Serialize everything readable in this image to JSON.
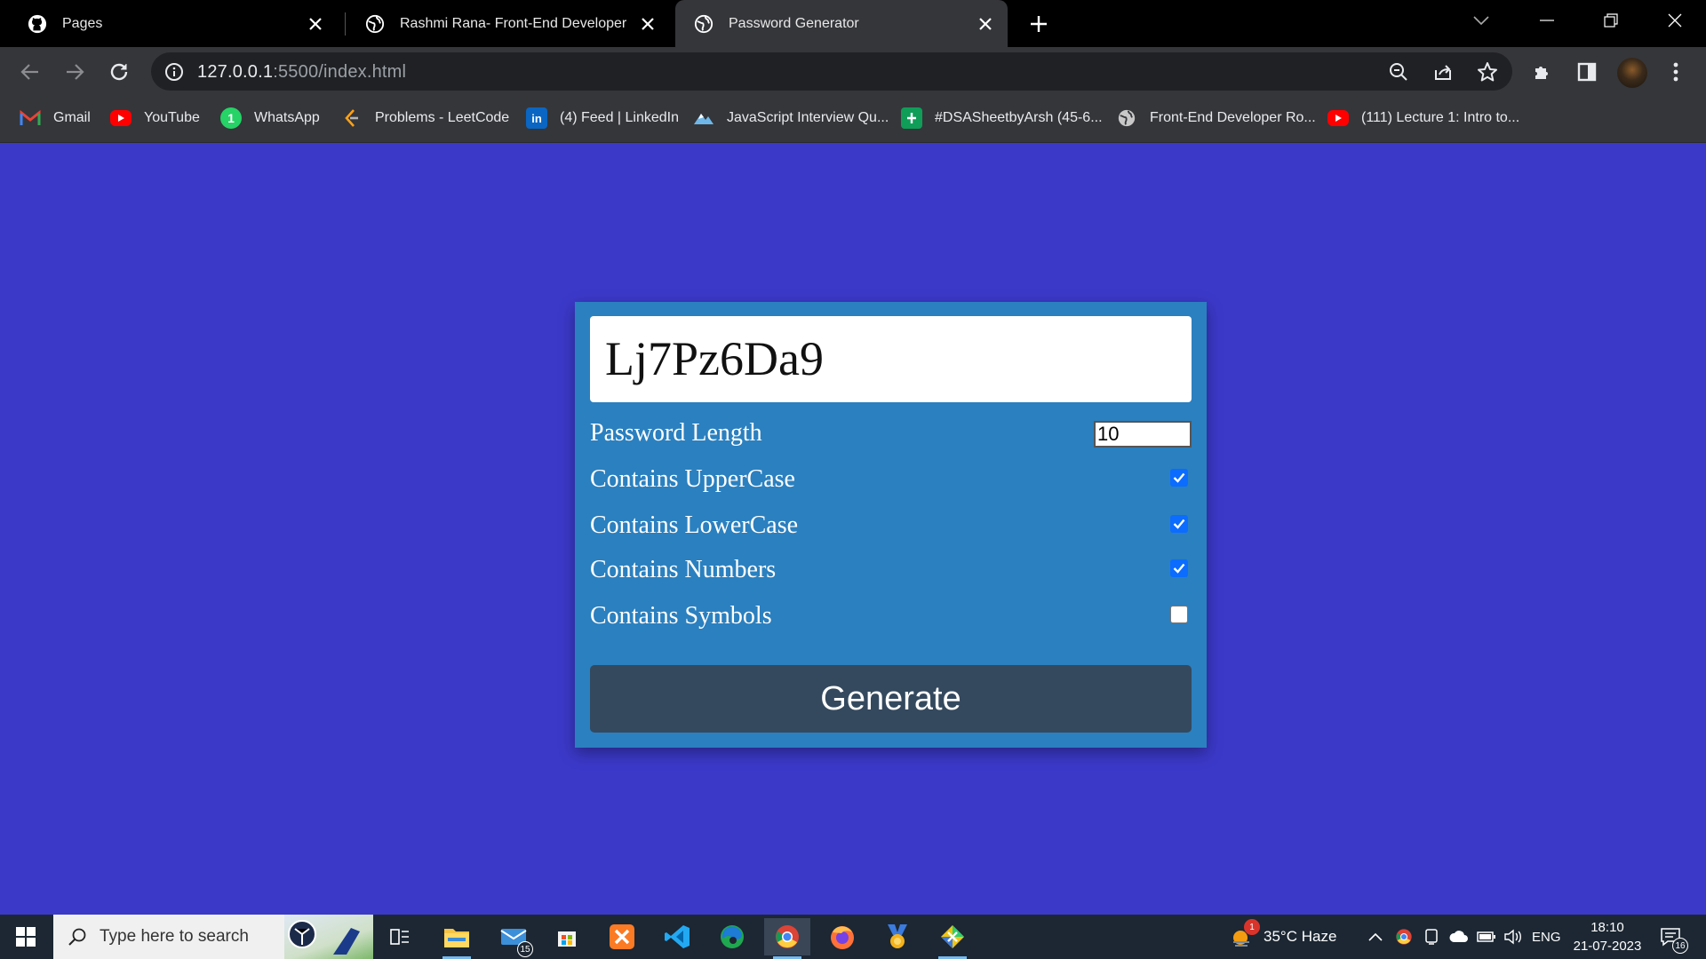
{
  "browser": {
    "tabs": [
      {
        "title": "Pages",
        "favicon": "github-icon",
        "active": false
      },
      {
        "title": "Rashmi Rana- Front-End Developer",
        "favicon": "globe-icon",
        "active": false
      },
      {
        "title": "Password Generator",
        "favicon": "globe-icon",
        "active": true
      }
    ],
    "url_host": "127.0.0.1",
    "url_rest": ":5500/index.html",
    "bookmarks": [
      {
        "label": "Gmail",
        "icon": "gmail-icon"
      },
      {
        "label": "YouTube",
        "icon": "youtube-icon"
      },
      {
        "label": "WhatsApp",
        "icon": "whatsapp-icon"
      },
      {
        "label": "Problems - LeetCode",
        "icon": "leetcode-icon"
      },
      {
        "label": "(4) Feed | LinkedIn",
        "icon": "linkedin-icon"
      },
      {
        "label": "JavaScript Interview Qu...",
        "icon": "mountain-icon"
      },
      {
        "label": "#DSASheetbyArsh (45-6...",
        "icon": "sheets-icon"
      },
      {
        "label": "Front-End Developer Ro...",
        "icon": "globe-icon"
      },
      {
        "label": "(111) Lecture 1: Intro to...",
        "icon": "youtube-icon"
      }
    ]
  },
  "app": {
    "password": "Lj7Pz6Da9",
    "length_label": "Password Length",
    "length_value": "10",
    "options": [
      {
        "label": "Contains UpperCase",
        "checked": true
      },
      {
        "label": "Contains LowerCase",
        "checked": true
      },
      {
        "label": "Contains Numbers",
        "checked": true
      },
      {
        "label": "Contains Symbols",
        "checked": false
      }
    ],
    "generate_label": "Generate"
  },
  "taskbar": {
    "search_placeholder": "Type here to search",
    "mail_badge": "15",
    "weather": "35°C  Haze",
    "weather_badge": "1",
    "lang": "ENG",
    "time": "18:10",
    "date": "21-07-2023",
    "notifications": "16"
  },
  "colors": {
    "page_bg": "#3b39c8",
    "card_bg": "#2b80bf",
    "button_bg": "#34495e",
    "checkbox_on": "#0b6cff"
  }
}
